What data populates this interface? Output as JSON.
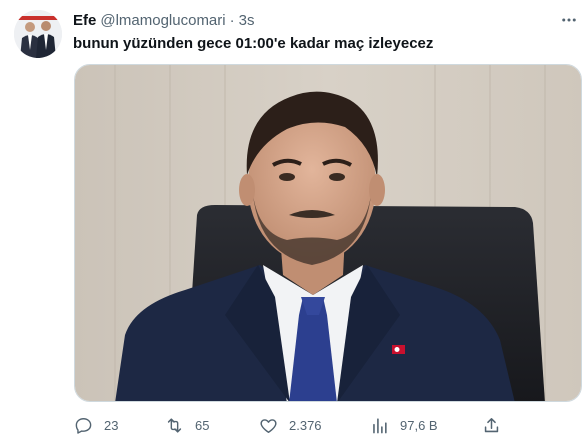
{
  "tweet": {
    "author_name": "Efe",
    "author_handle": "@lmamoglucomari",
    "separator": "·",
    "time": "3s",
    "text": "bunun yüzünden gece 01:00'e kadar maç izleyecez",
    "media_alt": "man in suit with blue tie seated in front of office chair"
  },
  "actions": {
    "reply_count": "23",
    "retweet_count": "65",
    "like_count": "2.376",
    "views_count": "97,6 B"
  },
  "icons": {
    "more": "more-dots-icon",
    "reply": "reply-icon",
    "retweet": "retweet-icon",
    "like": "heart-icon",
    "views": "views-chart-icon",
    "share": "share-icon"
  },
  "colors": {
    "text_primary": "#0f1419",
    "text_secondary": "#536471",
    "border": "#cfd9de"
  }
}
